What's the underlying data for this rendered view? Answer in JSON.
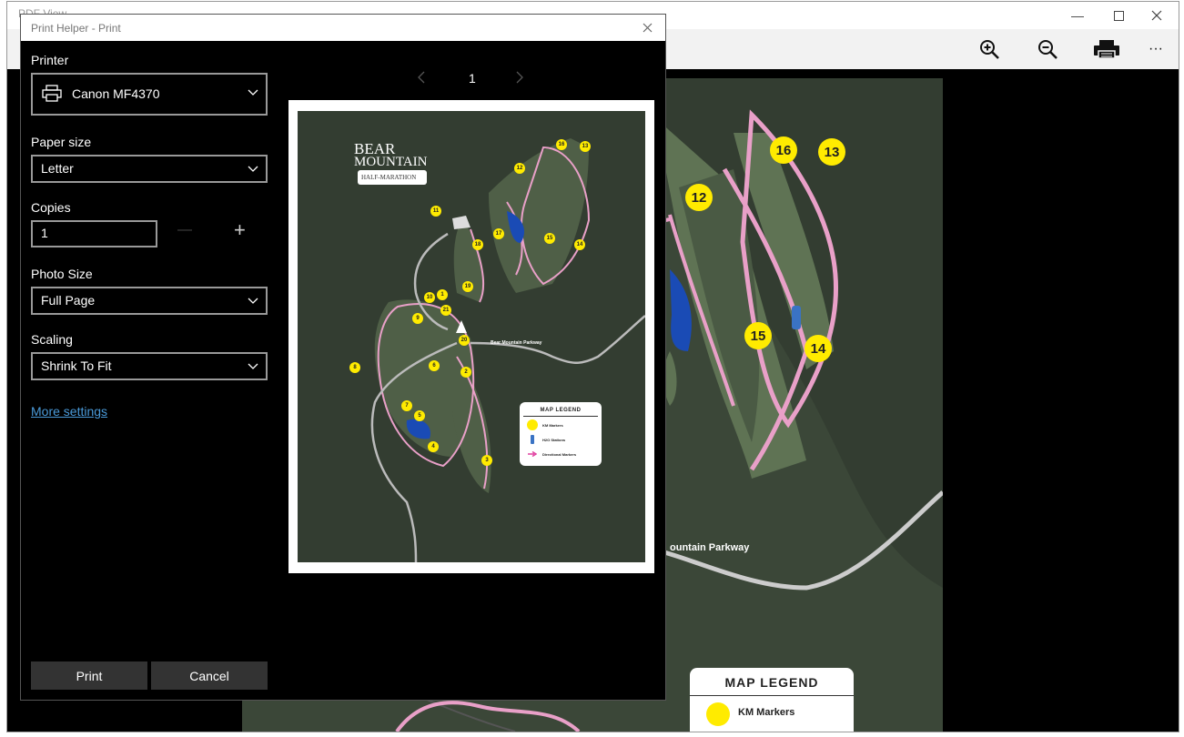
{
  "app": {
    "window_title": "PDF View",
    "toolbar": {
      "zoom_in_icon": "zoom-in-icon",
      "zoom_out_icon": "zoom-out-icon",
      "print_icon": "printer-icon",
      "more_label": "···"
    }
  },
  "document": {
    "road_label": "ountain Parkway",
    "legend_title": "MAP LEGEND",
    "legend_km": "KM Markers",
    "markers": [
      "16",
      "13",
      "12",
      "15",
      "14"
    ]
  },
  "dialog": {
    "title": "Print Helper - Print",
    "printer_label": "Printer",
    "printer_value": "Canon MF4370",
    "paper_size_label": "Paper size",
    "paper_size_value": "Letter",
    "copies_label": "Copies",
    "copies_value": "1",
    "copies_minus": "—",
    "copies_plus": "+",
    "photo_size_label": "Photo Size",
    "photo_size_value": "Full Page",
    "scaling_label": "Scaling",
    "scaling_value": "Shrink To Fit",
    "more_settings": "More settings",
    "print_button": "Print",
    "cancel_button": "Cancel",
    "page_number": "1"
  },
  "preview": {
    "logo_line1": "BEAR",
    "logo_line2": "MOUNTAIN",
    "logo_line3": "HALF-MARATHON",
    "road_label": "Bear Mountain Parkway",
    "legend_title": "MAP LEGEND",
    "legend_items": [
      "KM Markers",
      "H2O Stations",
      "Directional Markers"
    ],
    "markers": [
      "16",
      "13",
      "12",
      "11",
      "17",
      "18",
      "15",
      "14",
      "19",
      "10",
      "1",
      "21",
      "9",
      "20",
      "8",
      "6",
      "2",
      "7",
      "5",
      "4",
      "3"
    ]
  },
  "colors": {
    "map_bg": "#333d31",
    "marker": "#ffeb00",
    "trail": "#e9a0c8",
    "link": "#4a9ad9"
  }
}
